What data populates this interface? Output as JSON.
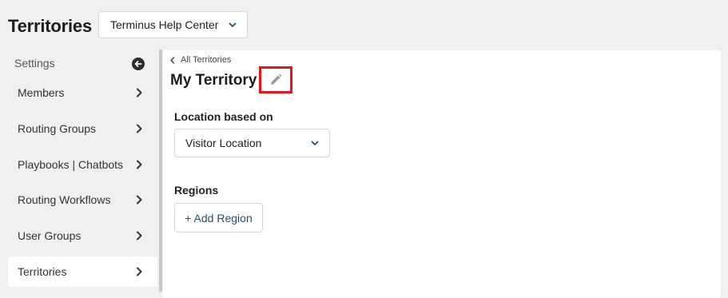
{
  "header": {
    "title": "Territories",
    "org_select": {
      "value": "Terminus Help Center",
      "icon": "chevron-down-icon"
    }
  },
  "sidebar": {
    "title": "Settings",
    "collapse_icon": "arrow-left-circle-icon",
    "items": [
      {
        "label": "Members",
        "active": false
      },
      {
        "label": "Routing Groups",
        "active": false
      },
      {
        "label": "Playbooks | Chatbots",
        "active": false
      },
      {
        "label": "Routing Workflows",
        "active": false
      },
      {
        "label": "User Groups",
        "active": false
      },
      {
        "label": "Territories",
        "active": true
      }
    ]
  },
  "main": {
    "back_link": "All Territories",
    "territory_name": "My Territory",
    "edit_icon": "pencil-icon",
    "highlight_color": "#e8141b",
    "location": {
      "label": "Location based on",
      "value": "Visitor Location"
    },
    "regions": {
      "label": "Regions",
      "add_button": "+ Add Region"
    }
  }
}
